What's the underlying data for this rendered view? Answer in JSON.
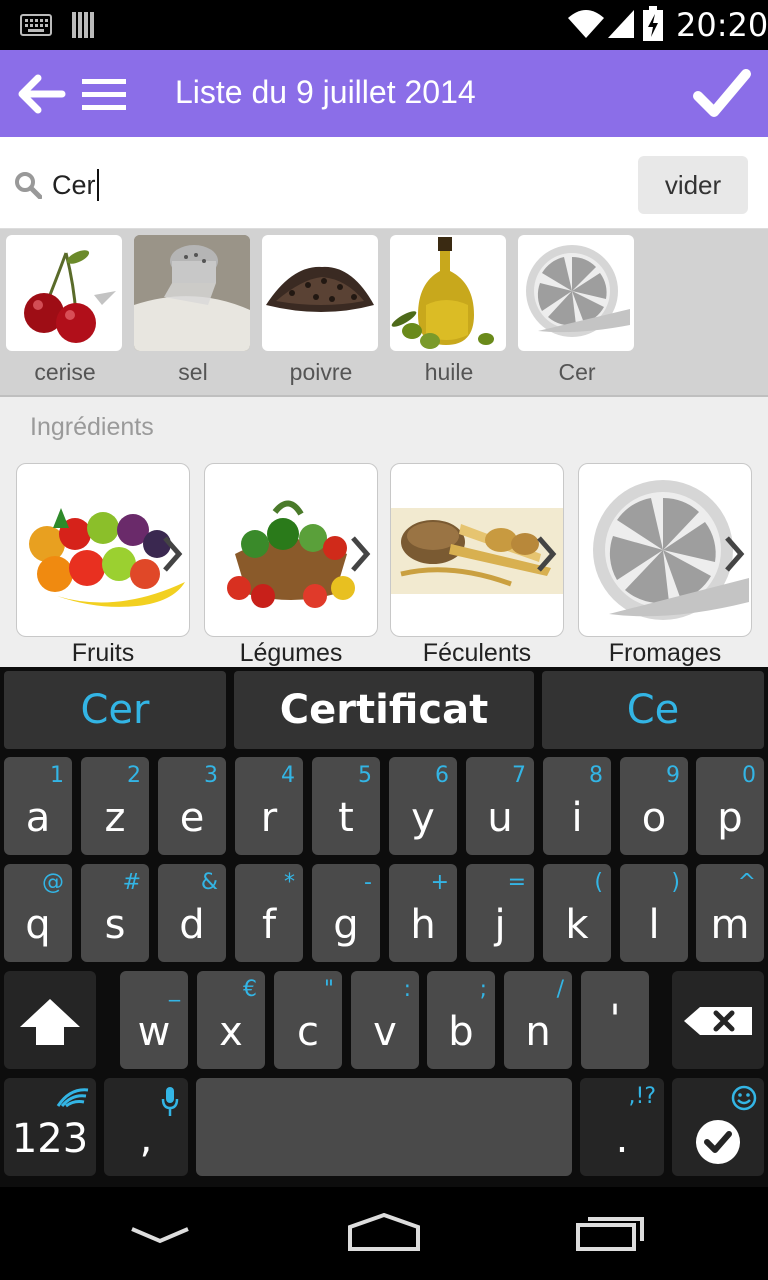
{
  "status_bar": {
    "time": "20:20",
    "icons": [
      "keyboard-icon",
      "sim-icon",
      "wifi-icon",
      "signal-icon",
      "battery-charging-icon"
    ]
  },
  "action_bar": {
    "title": "Liste du 9 juillet 2014",
    "color": "#8b6ee8",
    "icons": [
      "back-arrow-icon",
      "menu-icon",
      "checkmark-icon"
    ]
  },
  "search": {
    "value": "Cer",
    "clear_label": "vider"
  },
  "suggestions": [
    {
      "label": "cerise",
      "icon": "cherry-image"
    },
    {
      "label": "sel",
      "icon": "salt-image"
    },
    {
      "label": "poivre",
      "icon": "pepper-image"
    },
    {
      "label": "huile",
      "icon": "oil-image"
    },
    {
      "label": "Cer",
      "icon": "placeholder-lemon-image"
    }
  ],
  "ingredients": {
    "section_title": "Ingrédients",
    "categories": [
      {
        "label": "Fruits",
        "icon": "fruits-image"
      },
      {
        "label": "Légumes",
        "icon": "vegetables-image"
      },
      {
        "label": "Féculents",
        "icon": "starches-image"
      },
      {
        "label": "Fromages",
        "icon": "placeholder-lemon-image"
      }
    ]
  },
  "keyboard": {
    "predictions": [
      "Cer",
      "Certificat",
      "Ce"
    ],
    "row1": [
      {
        "ch": "a",
        "alt": "1"
      },
      {
        "ch": "z",
        "alt": "2"
      },
      {
        "ch": "e",
        "alt": "3"
      },
      {
        "ch": "r",
        "alt": "4"
      },
      {
        "ch": "t",
        "alt": "5"
      },
      {
        "ch": "y",
        "alt": "6"
      },
      {
        "ch": "u",
        "alt": "7"
      },
      {
        "ch": "i",
        "alt": "8"
      },
      {
        "ch": "o",
        "alt": "9"
      },
      {
        "ch": "p",
        "alt": "0"
      }
    ],
    "row2": [
      {
        "ch": "q",
        "alt": "@"
      },
      {
        "ch": "s",
        "alt": "#"
      },
      {
        "ch": "d",
        "alt": "&"
      },
      {
        "ch": "f",
        "alt": "*"
      },
      {
        "ch": "g",
        "alt": "-"
      },
      {
        "ch": "h",
        "alt": "+"
      },
      {
        "ch": "j",
        "alt": "="
      },
      {
        "ch": "k",
        "alt": "("
      },
      {
        "ch": "l",
        "alt": ")"
      },
      {
        "ch": "m",
        "alt": "^"
      }
    ],
    "row3": [
      {
        "ch": "w",
        "alt": "_"
      },
      {
        "ch": "x",
        "alt": "€"
      },
      {
        "ch": "c",
        "alt": "\""
      },
      {
        "ch": "v",
        "alt": ":"
      },
      {
        "ch": "b",
        "alt": ";"
      },
      {
        "ch": "n",
        "alt": "/"
      },
      {
        "ch": "'",
        "alt": ""
      }
    ],
    "numbers_label": "123",
    "comma": ",",
    "period": ".",
    "period_alt": ",!?",
    "accent": "#33b5e5"
  },
  "nav_bar": {
    "icons": [
      "back-chevron-icon",
      "home-icon",
      "recents-icon"
    ]
  }
}
